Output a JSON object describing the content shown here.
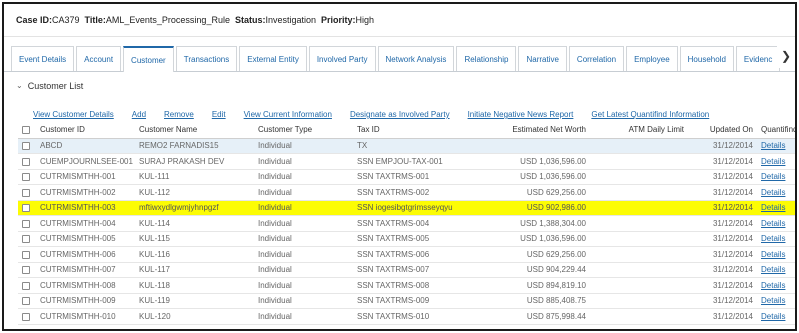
{
  "header": {
    "case_id_label": "Case ID:",
    "case_id": "CA379",
    "title_label": "Title:",
    "title": "AML_Events_Processing_Rule",
    "status_label": "Status:",
    "status": "Investigation",
    "priority_label": "Priority:",
    "priority": "High"
  },
  "tabs": [
    "Event Details",
    "Account",
    "Customer",
    "Transactions",
    "External Entity",
    "Involved Party",
    "Network Analysis",
    "Relationship",
    "Narrative",
    "Correlation",
    "Employee",
    "Household",
    "Evidenc"
  ],
  "active_tab": "Customer",
  "section": {
    "title": "Customer List"
  },
  "actions": [
    "View Customer Details",
    "Add",
    "Remove",
    "Edit",
    "View Current Information",
    "Designate as Involved Party",
    "Initiate Negative News Report",
    "Get Latest Quantifind Information"
  ],
  "table": {
    "headers": [
      "Customer ID",
      "Customer Name",
      "Customer Type",
      "Tax ID",
      "Estimated Net Worth",
      "ATM Daily Limit",
      "Updated On",
      "Quantifind"
    ],
    "rows": [
      [
        "ABCD",
        "REMO2 FARNADIS15",
        "Individual",
        "TX",
        "",
        "",
        "31/12/2014",
        "Details"
      ],
      [
        "CUEMPJOURNLSEE-001",
        "SURAJ PRAKASH DEV",
        "Individual",
        "SSN EMPJOU-TAX-001",
        "USD 1,036,596.00",
        "",
        "31/12/2014",
        "Details"
      ],
      [
        "CUTRMISMTHH-001",
        "KUL-111",
        "Individual",
        "SSN TAXTRMS-001",
        "USD 1,036,596.00",
        "",
        "31/12/2014",
        "Details"
      ],
      [
        "CUTRMISMTHH-002",
        "KUL-112",
        "Individual",
        "SSN TAXTRMS-002",
        "USD 629,256.00",
        "",
        "31/12/2014",
        "Details"
      ],
      [
        "CUTRMISMTHH-003",
        "mftiwxydlgwmjyhnpgzf",
        "Individual",
        "SSN iogesibgtgrimsseyqyu",
        "USD 902,986.00",
        "",
        "31/12/2014",
        "Details"
      ],
      [
        "CUTRMISMTHH-004",
        "KUL-114",
        "Individual",
        "SSN TAXTRMS-004",
        "USD 1,388,304.00",
        "",
        "31/12/2014",
        "Details"
      ],
      [
        "CUTRMISMTHH-005",
        "KUL-115",
        "Individual",
        "SSN TAXTRMS-005",
        "USD 1,036,596.00",
        "",
        "31/12/2014",
        "Details"
      ],
      [
        "CUTRMISMTHH-006",
        "KUL-116",
        "Individual",
        "SSN TAXTRMS-006",
        "USD 629,256.00",
        "",
        "31/12/2014",
        "Details"
      ],
      [
        "CUTRMISMTHH-007",
        "KUL-117",
        "Individual",
        "SSN TAXTRMS-007",
        "USD 904,229.44",
        "",
        "31/12/2014",
        "Details"
      ],
      [
        "CUTRMISMTHH-008",
        "KUL-118",
        "Individual",
        "SSN TAXTRMS-008",
        "USD 894,819.10",
        "",
        "31/12/2014",
        "Details"
      ],
      [
        "CUTRMISMTHH-009",
        "KUL-119",
        "Individual",
        "SSN TAXTRMS-009",
        "USD 885,408.75",
        "",
        "31/12/2014",
        "Details"
      ],
      [
        "CUTRMISMTHH-010",
        "KUL-120",
        "Individual",
        "SSN TAXTRMS-010",
        "USD 875,998.44",
        "",
        "31/12/2014",
        "Details"
      ]
    ],
    "selected_row": 0,
    "highlighted_row": 4
  },
  "colors": {
    "link": "#2068a8",
    "highlight": "#fcfc04",
    "selected": "#e6f0f8"
  },
  "icons": {
    "collapse": "chevron-down-icon",
    "tabs_next": "chevron-right-icon"
  }
}
